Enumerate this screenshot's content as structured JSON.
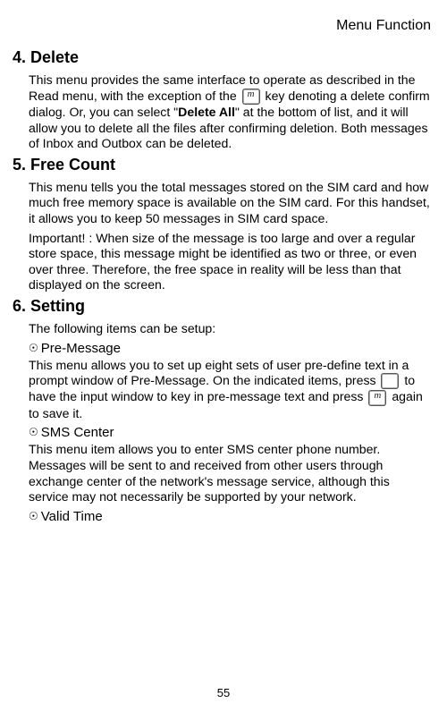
{
  "header": {
    "title": "Menu Function"
  },
  "sections": {
    "delete": {
      "heading": "4. Delete",
      "body_a": "This menu provides the same interface to operate as described in the Read menu, with the exception of the ",
      "body_b": " key denoting a delete confirm dialog.    Or, you can select \"",
      "bold": "Delete All",
      "body_c": "\" at the bottom of list, and it will allow you to delete all the files after confirming deletion.    Both messages of Inbox and Outbox can be deleted."
    },
    "freecount": {
      "heading": "5. Free Count",
      "body1": "This menu tells you the total messages stored on the SIM card and how much free memory space is available on the SIM card. For this handset, it allows you to keep 50 messages in SIM card space.",
      "body2": "Important! : When size of the message is too large and over a regular store space, this message might be identified as two or three, or even over three. Therefore, the free space in reality will be less than that displayed on the screen."
    },
    "setting": {
      "heading": "6. Setting",
      "intro": "The following items can be setup:",
      "premessage": {
        "label": "Pre-Message",
        "body_a": "This menu allows you to set up eight sets of user pre-define text in a prompt window of Pre-Message.      On the indicated items, press ",
        "body_b": " to have the input window to key in pre-message text and press ",
        "body_c": " again to save it."
      },
      "smscenter": {
        "label": "SMS Center",
        "body": "This menu item allows you to enter SMS center phone number. Messages will be sent to and received from other users through exchange center of the network's message service, although this service may not necessarily be supported by your network."
      },
      "validtime": {
        "label": "Valid Time"
      }
    }
  },
  "page_number": "55"
}
